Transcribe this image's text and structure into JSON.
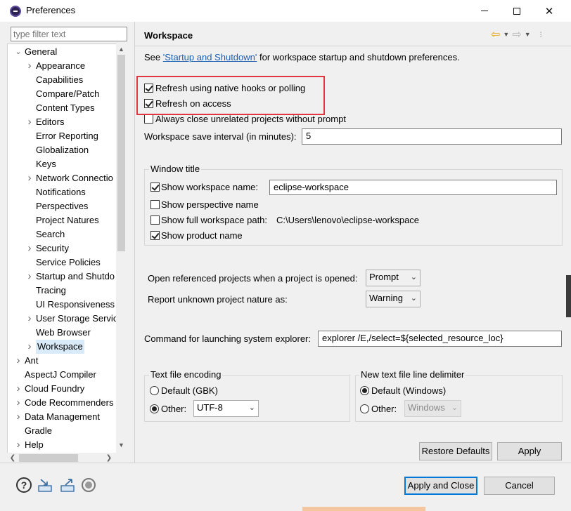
{
  "window": {
    "title": "Preferences"
  },
  "filter": {
    "placeholder": "type filter text"
  },
  "tree": [
    {
      "label": "General",
      "level": 0,
      "arrow": "expanded"
    },
    {
      "label": "Appearance",
      "level": 1,
      "arrow": "collapsed"
    },
    {
      "label": "Capabilities",
      "level": 1,
      "arrow": "none"
    },
    {
      "label": "Compare/Patch",
      "level": 1,
      "arrow": "none"
    },
    {
      "label": "Content Types",
      "level": 1,
      "arrow": "none"
    },
    {
      "label": "Editors",
      "level": 1,
      "arrow": "collapsed"
    },
    {
      "label": "Error Reporting",
      "level": 1,
      "arrow": "none"
    },
    {
      "label": "Globalization",
      "level": 1,
      "arrow": "none"
    },
    {
      "label": "Keys",
      "level": 1,
      "arrow": "none"
    },
    {
      "label": "Network Connectio",
      "level": 1,
      "arrow": "collapsed"
    },
    {
      "label": "Notifications",
      "level": 1,
      "arrow": "none"
    },
    {
      "label": "Perspectives",
      "level": 1,
      "arrow": "none"
    },
    {
      "label": "Project Natures",
      "level": 1,
      "arrow": "none"
    },
    {
      "label": "Search",
      "level": 1,
      "arrow": "none"
    },
    {
      "label": "Security",
      "level": 1,
      "arrow": "collapsed"
    },
    {
      "label": "Service Policies",
      "level": 1,
      "arrow": "none"
    },
    {
      "label": "Startup and Shutdo",
      "level": 1,
      "arrow": "collapsed"
    },
    {
      "label": "Tracing",
      "level": 1,
      "arrow": "none"
    },
    {
      "label": "UI Responsiveness",
      "level": 1,
      "arrow": "none"
    },
    {
      "label": "User Storage Servic",
      "level": 1,
      "arrow": "collapsed"
    },
    {
      "label": "Web Browser",
      "level": 1,
      "arrow": "none"
    },
    {
      "label": "Workspace",
      "level": 1,
      "arrow": "collapsed",
      "selected": true
    },
    {
      "label": "Ant",
      "level": 0,
      "arrow": "collapsed"
    },
    {
      "label": "AspectJ Compiler",
      "level": 0,
      "arrow": "none"
    },
    {
      "label": "Cloud Foundry",
      "level": 0,
      "arrow": "collapsed"
    },
    {
      "label": "Code Recommenders",
      "level": 0,
      "arrow": "collapsed"
    },
    {
      "label": "Data Management",
      "level": 0,
      "arrow": "collapsed"
    },
    {
      "label": "Gradle",
      "level": 0,
      "arrow": "none"
    },
    {
      "label": "Help",
      "level": 0,
      "arrow": "collapsed"
    }
  ],
  "page": {
    "title": "Workspace",
    "see_prefix": "See ",
    "see_link": "'Startup and Shutdown'",
    "see_suffix": " for workspace startup and shutdown preferences."
  },
  "options": {
    "refresh_native": {
      "label": "Refresh using native hooks or polling",
      "checked": true
    },
    "refresh_access": {
      "label": "Refresh on access",
      "checked": true
    },
    "always_close": {
      "label": "Always close unrelated projects without prompt",
      "checked": false
    }
  },
  "save_interval": {
    "label": "Workspace save interval (in minutes):",
    "value": "5"
  },
  "window_title": {
    "group_label": "Window title",
    "show_ws_name": {
      "label": "Show workspace name:",
      "checked": true,
      "value": "eclipse-workspace"
    },
    "show_perspective": {
      "label": "Show perspective name",
      "checked": false
    },
    "show_full_path": {
      "label": "Show full workspace path:",
      "checked": false,
      "path": "C:\\Users\\lenovo\\eclipse-workspace"
    },
    "show_product": {
      "label": "Show product name",
      "checked": true
    }
  },
  "open_ref": {
    "label": "Open referenced projects when a project is opened:",
    "value": "Prompt"
  },
  "unknown_nature": {
    "label": "Report unknown project nature as:",
    "value": "Warning"
  },
  "explorer_cmd": {
    "label": "Command for launching system explorer:",
    "value": "explorer /E,/select=${selected_resource_loc}"
  },
  "encoding": {
    "group_label": "Text file encoding",
    "default_label": "Default (GBK)",
    "other_label": "Other:",
    "other_value": "UTF-8"
  },
  "line_delim": {
    "group_label": "New text file line delimiter",
    "default_label": "Default (Windows)",
    "other_label": "Other:",
    "other_value": "Windows"
  },
  "buttons": {
    "restore": "Restore Defaults",
    "apply": "Apply",
    "apply_close": "Apply and Close",
    "cancel": "Cancel"
  },
  "icons": {
    "help": "help-icon",
    "import": "import-icon",
    "export": "export-icon",
    "record": "record-icon"
  },
  "colors": {
    "highlight_box": "#e2373f",
    "link": "#1a5fb4",
    "selection": "#d9ebf9",
    "default_button_border": "#0078d7"
  }
}
